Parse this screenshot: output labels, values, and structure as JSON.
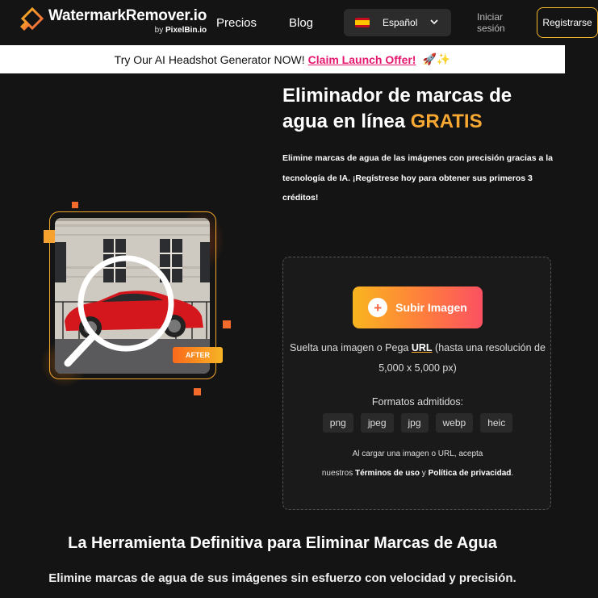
{
  "nav": {
    "logo_title": "WatermarkRemover.io",
    "logo_by": "by ",
    "logo_brand": "PixelBin.io",
    "precios": "Precios",
    "blog": "Blog",
    "language": "Español",
    "login_line1": "Iniciar",
    "login_line2": "sesión",
    "register": "Registrarse"
  },
  "banner": {
    "text": "Try Our AI Headshot Generator NOW!",
    "link": "Claim Launch Offer!",
    "emoji": "🚀✨"
  },
  "hero": {
    "title_part1": "Eliminador de marcas de agua en línea ",
    "title_highlight": "GRATIS",
    "description": "Elimine marcas de agua de las imágenes con precisión gracias a la tecnología de IA. ¡Regístrese hoy para obtener sus primeros 3 créditos!"
  },
  "illustration": {
    "after_label": "AFTER"
  },
  "upload": {
    "button_label": "Subir Imagen",
    "drop_prefix": "Suelta una imagen o Pega ",
    "drop_url": "URL",
    "drop_suffix": " (hasta una resolución de 5,000 x 5,000 px)",
    "formats_label": "Formatos admitidos:",
    "formats": [
      "png",
      "jpeg",
      "jpg",
      "webp",
      "heic"
    ],
    "terms_line1": "Al cargar una imagen o URL, acepta",
    "terms_prefix": "nuestros ",
    "terms_link": "Términos de uso",
    "terms_and": " y ",
    "privacy_link": "Política de privacidad",
    "terms_end": "."
  },
  "section": {
    "title": "La Herramienta Definitiva para Eliminar Marcas de Agua",
    "subtitle": "Elimine marcas de agua de sus imágenes sin esfuerzo con velocidad y precisión."
  },
  "colors": {
    "accent": "#f7a833",
    "pink": "#e5176f",
    "background": "#141414"
  }
}
